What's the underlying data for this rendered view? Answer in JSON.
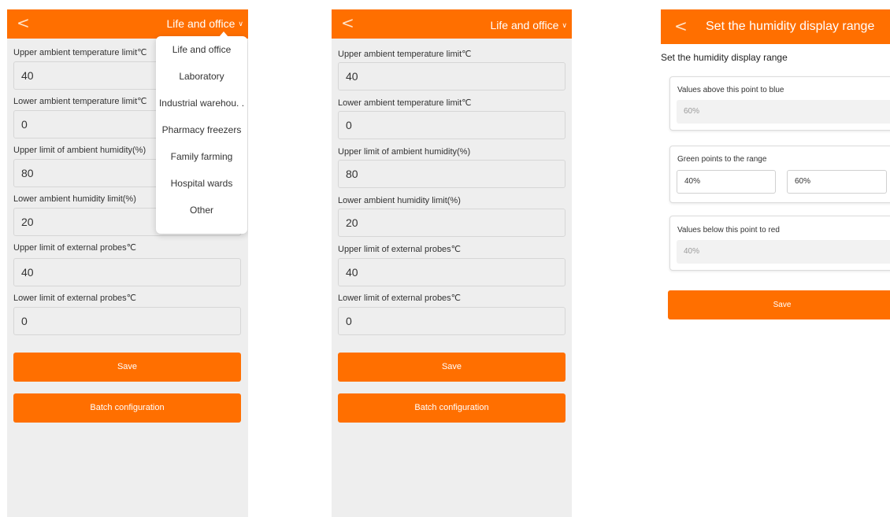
{
  "header": {
    "back_glyph": "<",
    "mode": "Life and office",
    "chevron": "∨"
  },
  "fields": [
    {
      "label": "Upper ambient temperature limit℃",
      "value": "40"
    },
    {
      "label": "Lower ambient temperature limit℃",
      "value": "0"
    },
    {
      "label": "Upper limit of ambient humidity(%)",
      "value": "80"
    },
    {
      "label": "Lower ambient humidity limit(%)",
      "value": "20"
    },
    {
      "label": "Upper limit of external probes℃",
      "value": "40"
    },
    {
      "label": "Lower limit of external probes℃",
      "value": "0"
    }
  ],
  "buttons": {
    "save": "Save",
    "batch": "Batch configuration"
  },
  "dropdown": {
    "options": [
      "Life and office",
      "Laboratory",
      "Industrial warehou. .",
      "Pharmacy freezers",
      "Family farming",
      "Hospital wards",
      "Other"
    ]
  },
  "humidity": {
    "title": "Set the humidity display range",
    "heading": "Set the humidity display range",
    "blue_label": "Values above this point to blue",
    "blue_value": "60%",
    "green_label": "Green points to the range",
    "green_low": "40%",
    "green_high": "60%",
    "red_label": "Values below this point to red",
    "red_value": "40%",
    "save": "Save"
  },
  "colors": {
    "accent": "#ff6f00",
    "background": "#eeeeee"
  },
  "icons": {
    "back": "chevron-left-icon",
    "dropdown": "chevron-down-icon"
  }
}
